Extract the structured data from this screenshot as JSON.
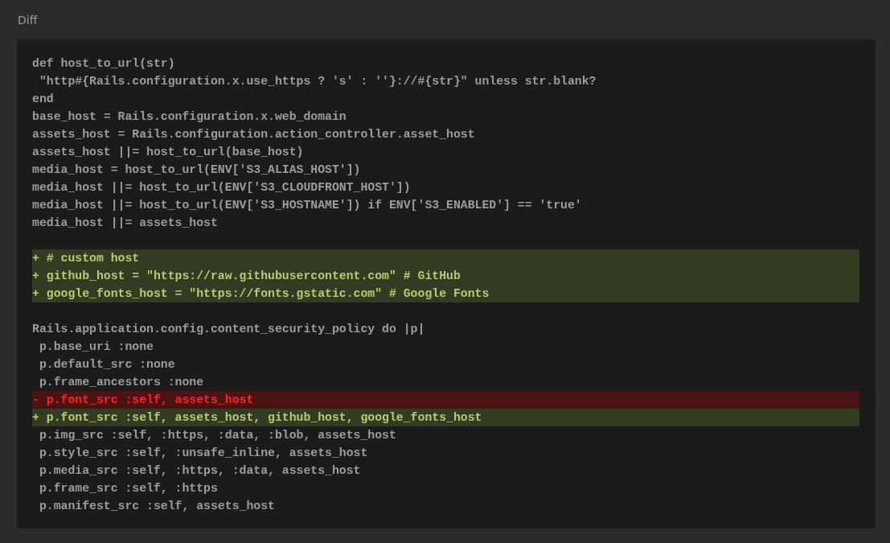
{
  "title": "Diff",
  "lines": [
    {
      "kind": "context",
      "text": "def host_to_url(str)"
    },
    {
      "kind": "context",
      "text": " \"http#{Rails.configuration.x.use_https ? 's' : ''}://#{str}\" unless str.blank?"
    },
    {
      "kind": "context",
      "text": "end"
    },
    {
      "kind": "context",
      "text": "base_host = Rails.configuration.x.web_domain"
    },
    {
      "kind": "context",
      "text": "assets_host = Rails.configuration.action_controller.asset_host"
    },
    {
      "kind": "context",
      "text": "assets_host ||= host_to_url(base_host)"
    },
    {
      "kind": "context",
      "text": "media_host = host_to_url(ENV['S3_ALIAS_HOST'])"
    },
    {
      "kind": "context",
      "text": "media_host ||= host_to_url(ENV['S3_CLOUDFRONT_HOST'])"
    },
    {
      "kind": "context",
      "text": "media_host ||= host_to_url(ENV['S3_HOSTNAME']) if ENV['S3_ENABLED'] == 'true'"
    },
    {
      "kind": "context",
      "text": "media_host ||= assets_host"
    },
    {
      "kind": "blank"
    },
    {
      "kind": "added",
      "text": "+ # custom host"
    },
    {
      "kind": "added",
      "text": "+ github_host = \"https://raw.githubusercontent.com\" # GitHub"
    },
    {
      "kind": "added",
      "text": "+ google_fonts_host = \"https://fonts.gstatic.com\" # Google Fonts"
    },
    {
      "kind": "blank"
    },
    {
      "kind": "context",
      "text": "Rails.application.config.content_security_policy do |p|"
    },
    {
      "kind": "context",
      "text": " p.base_uri :none"
    },
    {
      "kind": "context",
      "text": " p.default_src :none"
    },
    {
      "kind": "context",
      "text": " p.frame_ancestors :none"
    },
    {
      "kind": "removed",
      "text": "- p.font_src :self, assets_host"
    },
    {
      "kind": "added",
      "text": "+ p.font_src :self, assets_host, github_host, google_fonts_host"
    },
    {
      "kind": "context",
      "text": " p.img_src :self, :https, :data, :blob, assets_host"
    },
    {
      "kind": "context",
      "text": " p.style_src :self, :unsafe_inline, assets_host"
    },
    {
      "kind": "context",
      "text": " p.media_src :self, :https, :data, assets_host"
    },
    {
      "kind": "context",
      "text": " p.frame_src :self, :https"
    },
    {
      "kind": "context",
      "text": " p.manifest_src :self, assets_host"
    }
  ]
}
